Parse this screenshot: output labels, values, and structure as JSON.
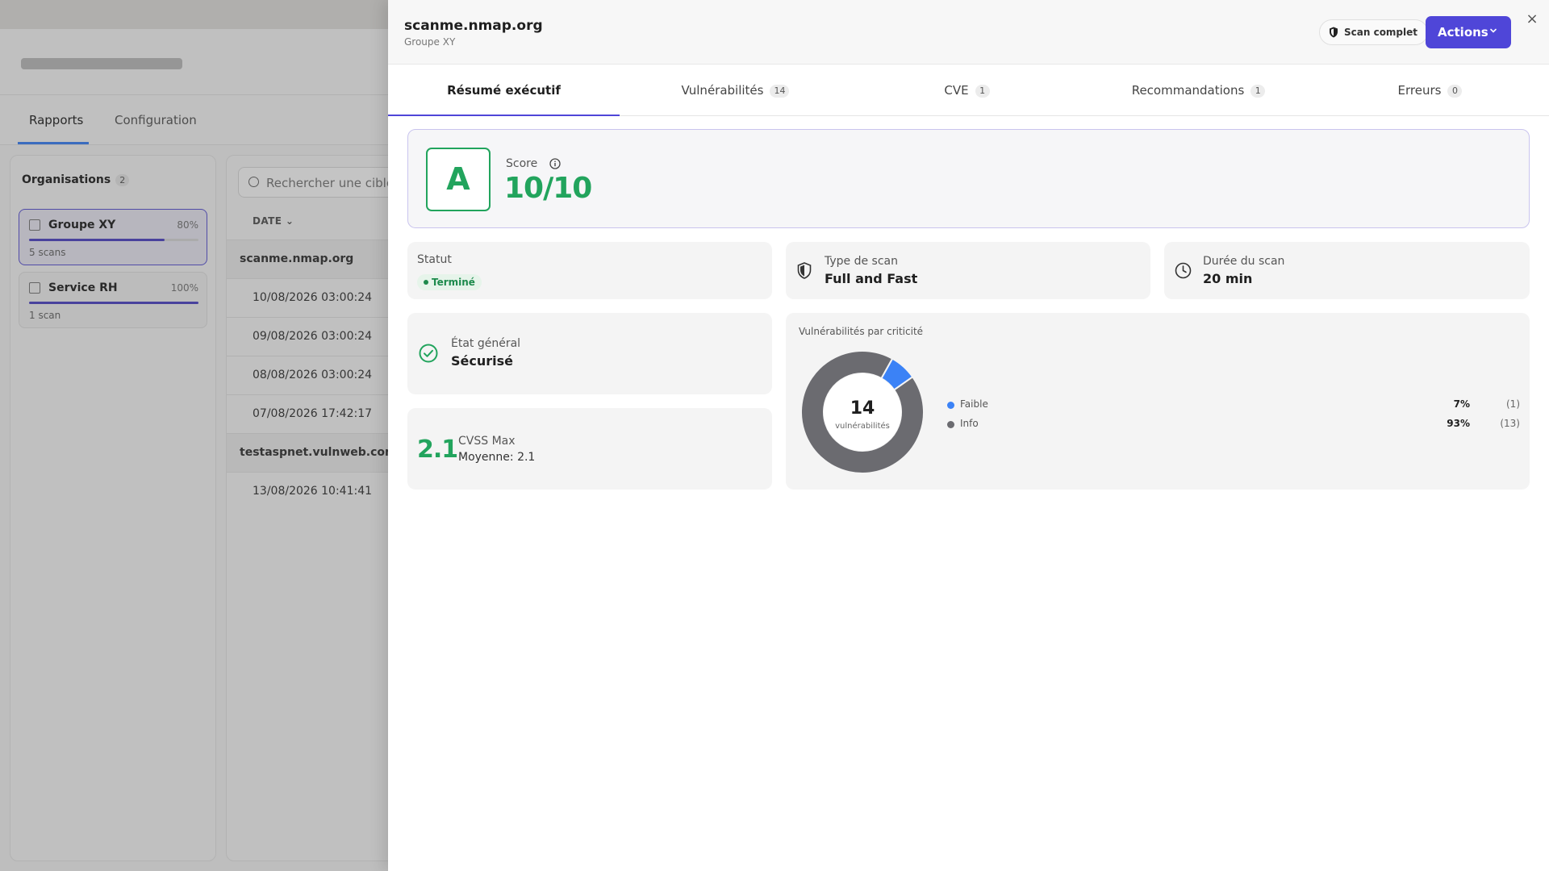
{
  "background": {
    "tabs": [
      {
        "label": "Rapports",
        "active": true
      },
      {
        "label": "Configuration",
        "active": false
      }
    ],
    "organisations": {
      "title": "Organisations",
      "count": "2",
      "items": [
        {
          "name": "Groupe XY",
          "percent": "80%",
          "progress": 0.8,
          "sub": "5 scans",
          "selected": true
        },
        {
          "name": "Service RH",
          "percent": "100%",
          "progress": 1.0,
          "sub": "1 scan",
          "selected": false
        }
      ]
    },
    "search_placeholder": "Rechercher une cible o",
    "column_header": "DATE",
    "rows": [
      {
        "text": "scanme.nmap.org",
        "group": true
      },
      {
        "text": "10/08/2026 03:00:24",
        "group": false
      },
      {
        "text": "09/08/2026 03:00:24",
        "group": false
      },
      {
        "text": "08/08/2026 03:00:24",
        "group": false
      },
      {
        "text": "07/08/2026 17:42:17",
        "group": false
      },
      {
        "text": "testaspnet.vulnweb.com",
        "group": true
      },
      {
        "text": "13/08/2026 10:41:41",
        "group": false
      }
    ]
  },
  "drawer": {
    "title": "scanme.nmap.org",
    "subtitle": "Groupe XY",
    "scan_badge": "Scan complet",
    "actions_label": "Actions",
    "close_symbol": "×",
    "tabs": [
      {
        "label": "Résumé exécutif",
        "count": "",
        "active": true
      },
      {
        "label": "Vulnérabilités",
        "count": "14",
        "active": false
      },
      {
        "label": "CVE",
        "count": "1",
        "active": false
      },
      {
        "label": "Recommandations",
        "count": "1",
        "active": false
      },
      {
        "label": "Erreurs",
        "count": "0",
        "active": false
      }
    ],
    "score": {
      "grade": "A",
      "label": "Score",
      "value": "10/10"
    },
    "status": {
      "label": "Statut",
      "value": "Terminé"
    },
    "scan_type": {
      "label": "Type de scan",
      "value": "Full and Fast"
    },
    "duration": {
      "label": "Durée du scan",
      "value": "20 min"
    },
    "general_state": {
      "label": "État général",
      "value": "Sécurisé"
    },
    "cvss": {
      "value": "2.1",
      "label": "CVSS Max",
      "average": "Moyenne: 2.1"
    },
    "vulnerabilities": {
      "title": "Vulnérabilités par criticité",
      "total": "14",
      "total_label": "vulnérabilités"
    }
  },
  "colors": {
    "accent": "#4f46d8",
    "success": "#22a45d",
    "faible": "#3b82f6",
    "info": "#6b6b70"
  },
  "chart_data": {
    "type": "pie",
    "categories": [
      "Faible",
      "Info"
    ],
    "values": [
      1,
      13
    ],
    "percent_labels": [
      "7%",
      "93%"
    ],
    "count_labels": [
      "(1)",
      "(13)"
    ],
    "colors": [
      "#3b82f6",
      "#6b6b70"
    ],
    "title": "Vulnérabilités par criticité",
    "legend": "right"
  }
}
